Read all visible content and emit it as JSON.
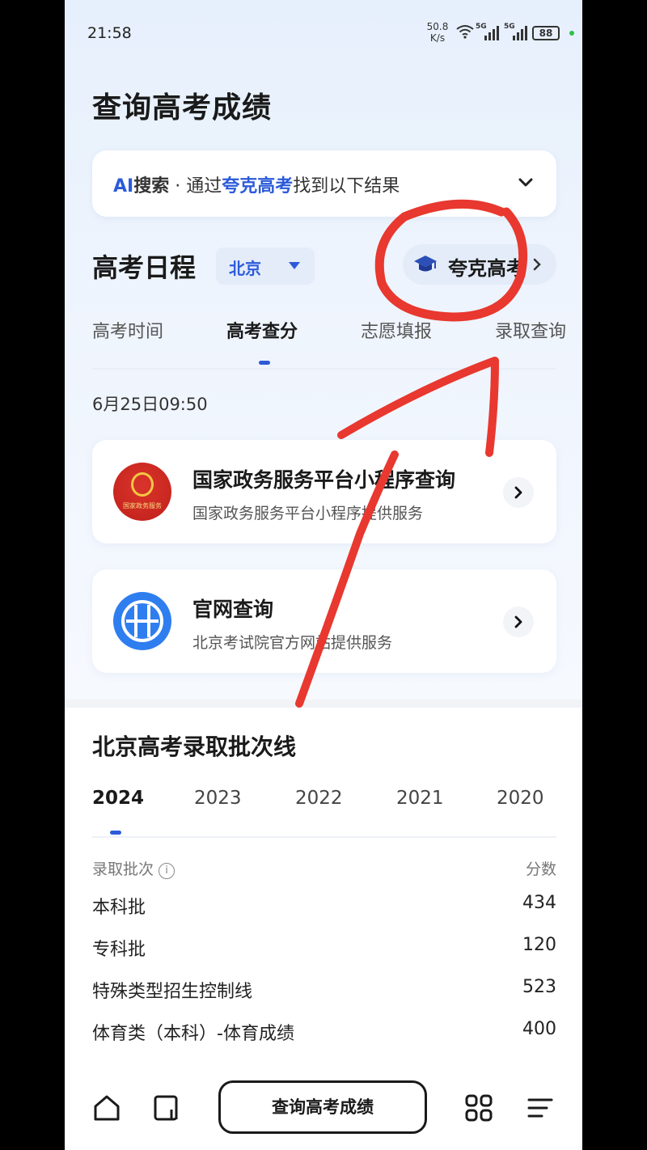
{
  "status_bar": {
    "time": "21:58",
    "net_speed_value": "50.8",
    "net_speed_unit": "K/s",
    "signal_1": "5G",
    "signal_2": "5G",
    "battery": "88"
  },
  "page": {
    "title": "查询高考成绩"
  },
  "ai_search": {
    "prefix_ai": "AI",
    "prefix_search": "搜索",
    "middle": " · 通过",
    "source": "夸克高考",
    "suffix": "找到以下结果"
  },
  "schedule": {
    "title": "高考日程",
    "region": "北京",
    "brand_label": "夸克高考",
    "tabs": [
      {
        "label": "高考时间"
      },
      {
        "label": "高考查分"
      },
      {
        "label": "志愿填报"
      },
      {
        "label": "录取查询"
      }
    ],
    "date": "6月25日09:50"
  },
  "cards": [
    {
      "title": "国家政务服务平台小程序查询",
      "subtitle": "国家政务服务平台小程序提供服务",
      "logo_caption": "国家政务服务"
    },
    {
      "title": "官网查询",
      "subtitle": "北京考试院官方网站提供服务"
    }
  ],
  "cutoff": {
    "title": "北京高考录取批次线",
    "years": [
      "2024",
      "2023",
      "2022",
      "2021",
      "2020"
    ],
    "col_batch": "录取批次",
    "col_score": "分数",
    "info_glyph": "i",
    "rows": [
      {
        "name": "本科批",
        "score": "434"
      },
      {
        "name": "专科批",
        "score": "120"
      },
      {
        "name": "特殊类型招生控制线",
        "score": "523"
      },
      {
        "name": "体育类（本科）-体育成绩",
        "score": "400"
      }
    ]
  },
  "bottom_bar": {
    "search_label": "查询高考成绩"
  },
  "colors": {
    "accent": "#2c5bd9",
    "annotation": "#e8382f"
  }
}
